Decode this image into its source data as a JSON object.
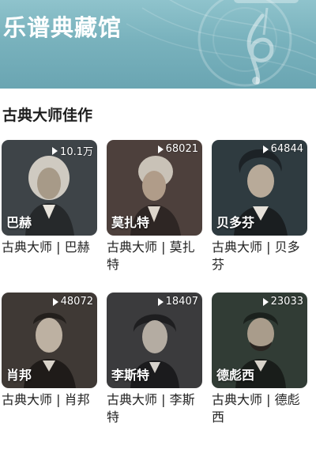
{
  "header": {
    "title": "乐谱典藏馆"
  },
  "section": {
    "title": "古典大师佳作"
  },
  "cards": [
    {
      "name": "巴赫",
      "plays": "10.1万",
      "caption": "古典大师 | 巴赫",
      "color": "#3a4045"
    },
    {
      "name": "莫扎特",
      "plays": "68021",
      "caption": "古典大师 | 莫扎特",
      "color": "#4a3d3a"
    },
    {
      "name": "贝多芬",
      "plays": "64844",
      "caption": "古典大师 | 贝多芬",
      "color": "#2e3a3f"
    },
    {
      "name": "肖邦",
      "plays": "48072",
      "caption": "古典大师 | 肖邦",
      "color": "#3d3733"
    },
    {
      "name": "李斯特",
      "plays": "18407",
      "caption": "古典大师 | 李斯特",
      "color": "#3a3a3c"
    },
    {
      "name": "德彪西",
      "plays": "23033",
      "caption": "古典大师 | 德彪西",
      "color": "#2f3a33"
    }
  ],
  "icons": {
    "play": "play-icon",
    "banner_decoration": "treble-clef-icon"
  }
}
